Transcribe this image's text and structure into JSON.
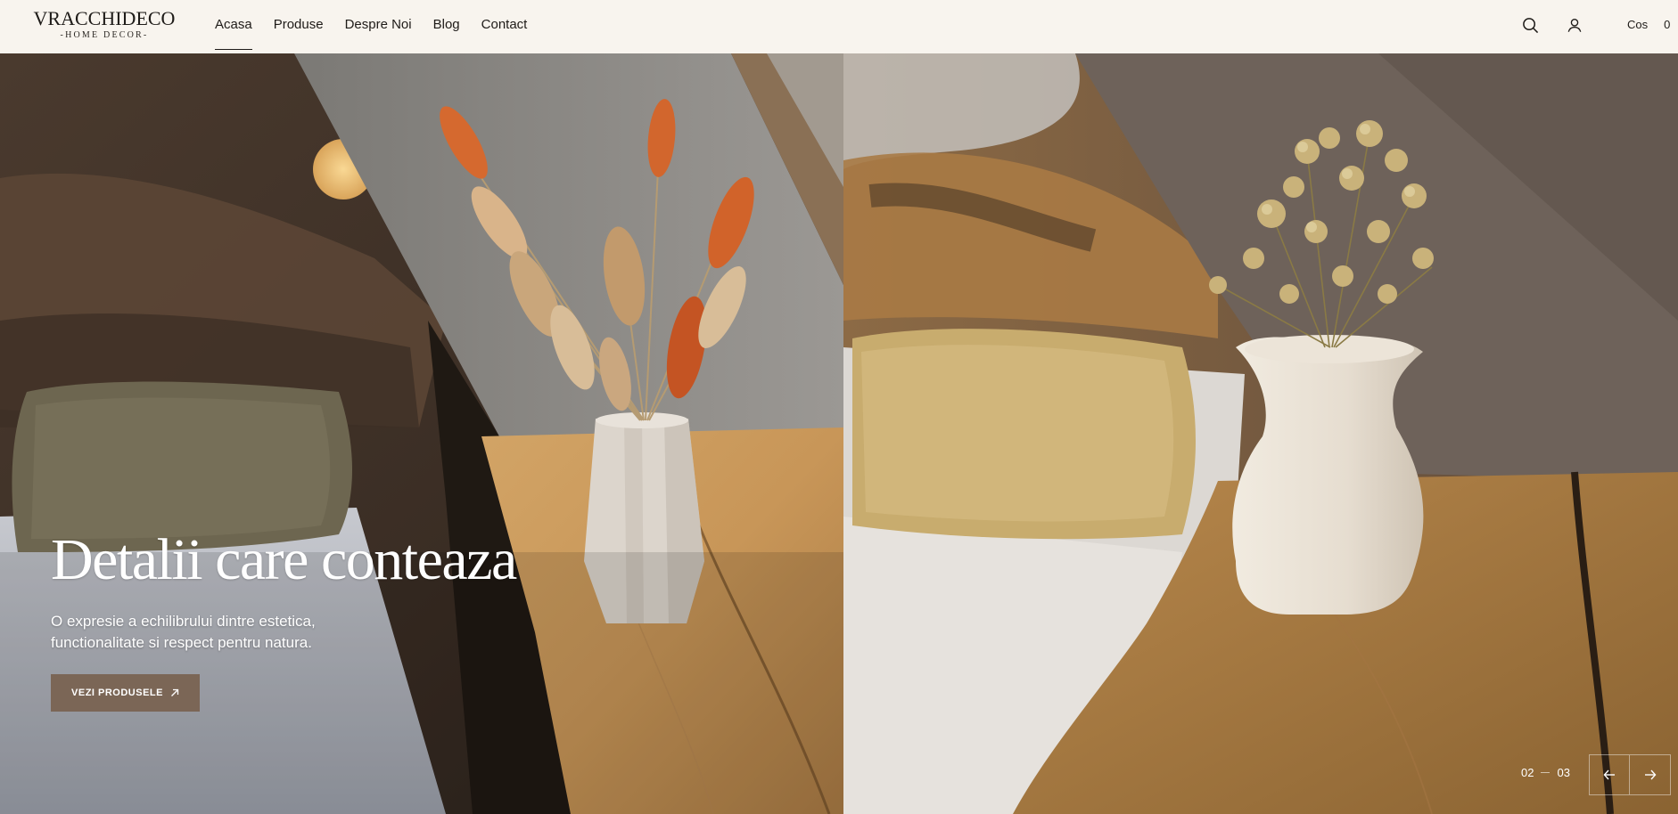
{
  "brand": {
    "name": "VRACCHIDECO",
    "tagline": "-HOME DECOR-"
  },
  "nav": {
    "items": [
      {
        "label": "Acasa",
        "active": true
      },
      {
        "label": "Produse"
      },
      {
        "label": "Despre Noi"
      },
      {
        "label": "Blog"
      },
      {
        "label": "Contact"
      }
    ]
  },
  "header": {
    "search_icon": "search-icon",
    "account_icon": "user-icon",
    "cart_label": "Cos",
    "cart_count": "0"
  },
  "hero": {
    "title": "Detalii care conteaza",
    "subtitle": "O expresie a echilibrului dintre estetica, functionalitate si respect pentru natura.",
    "cta_label": "VEZI PRODUSELE",
    "cta_icon": "arrow-up-right-icon",
    "slide_current": "02",
    "slide_total": "03",
    "prev_icon": "arrow-left-icon",
    "next_icon": "arrow-right-icon"
  },
  "colors": {
    "header_bg": "#f8f4ee",
    "cta_bg": "#7b6656",
    "text_dark": "#1e1b18"
  }
}
